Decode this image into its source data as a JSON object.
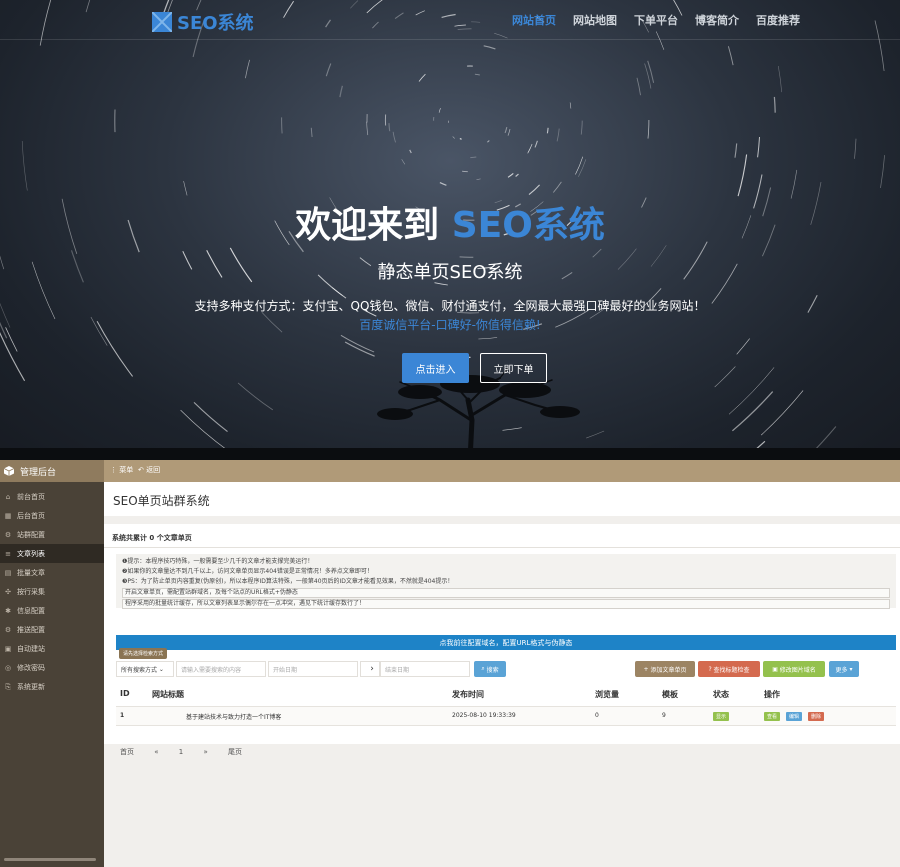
{
  "site": {
    "logo_text": "SEO系统",
    "nav": [
      "网站首页",
      "网站地图",
      "下单平台",
      "博客简介",
      "百度推荐"
    ],
    "active_nav": "网站首页"
  },
  "hero": {
    "title_prefix": "欢迎来到 ",
    "title_accent": "SEO系统",
    "subtitle": "静态单页SEO系统",
    "description": "支持多种支付方式：支付宝、QQ钱包、微信、财付通支付，全网最大最强口碑最好的业务网站！",
    "link_text": "百度诚信平台-口碑好-你值得信赖!",
    "btn_enter": "点击进入",
    "btn_order": "立即下单",
    "accent_color": "#3b86d6"
  },
  "admin": {
    "brand": "管理后台",
    "top_menu": "菜单",
    "top_back": "返回",
    "sidebar": [
      {
        "label": "前台首页",
        "icon": "home-icon"
      },
      {
        "label": "后台首页",
        "icon": "dashboard-icon"
      },
      {
        "label": "站群配置",
        "icon": "settings-icon"
      },
      {
        "label": "文章列表",
        "icon": "list-icon",
        "active": true
      },
      {
        "label": "批量文章",
        "icon": "batch-icon"
      },
      {
        "label": "按行采集",
        "icon": "collect-icon"
      },
      {
        "label": "信息配置",
        "icon": "info-icon"
      },
      {
        "label": "推送配置",
        "icon": "push-icon"
      },
      {
        "label": "自动建站",
        "icon": "auto-icon"
      },
      {
        "label": "修改密码",
        "icon": "lock-icon"
      },
      {
        "label": "系统更新",
        "icon": "update-icon"
      }
    ],
    "page_title": "SEO单页站群系统",
    "panel_header": "系统共累计 0 个文章单页",
    "notices": [
      "❶提示：本程序技巧特殊，一般需要至少几千的文章才能支撑完美运行！",
      "❷如果你的文章量达不到几千以上，访问文章单页显示404错误是正常情况！多养点文章即可！",
      "❸PS：为了防止单页内容重复(伪原创)，所以本程序ID算法特殊，一般第40页后的ID文章才能看见效果，不然就是404提示！"
    ],
    "notice_boxes": [
      "开启文章单页，需配置站群域名，及每个站点的URL格式+伪静态",
      "程序采用的批量统计缓存，所以文章列表显示偶尔存在一点冲突，遇见下统计缓存数行了！"
    ],
    "blue_bar": "点我前往配置域名，配置URL格式与伪静态",
    "tooltip": "请先选择检索方式",
    "filter": {
      "select": "所有搜索方式",
      "keyword_placeholder": "请输入需要搜索的内容",
      "start_placeholder": "开始日期",
      "end_placeholder": "结束日期",
      "search_btn": "搜索"
    },
    "buttons": {
      "add": "添加文章单页",
      "check": "查找标题检查",
      "img_domain": "修改图片域名",
      "more": "更多"
    },
    "table": {
      "headers": [
        "ID",
        "网站标题",
        "发布时间",
        "浏览量",
        "模板",
        "状态",
        "操作"
      ],
      "rows": [
        {
          "id": "1",
          "title": "基于建站技术与致力打造一个IT博客",
          "time": "2025-08-10 19:33:39",
          "views": "0",
          "template": "9",
          "status": "显示",
          "actions": [
            "查看",
            "编辑",
            "删除"
          ]
        }
      ]
    },
    "pager": [
      "首页",
      "«",
      "1",
      "»",
      "尾页"
    ]
  }
}
